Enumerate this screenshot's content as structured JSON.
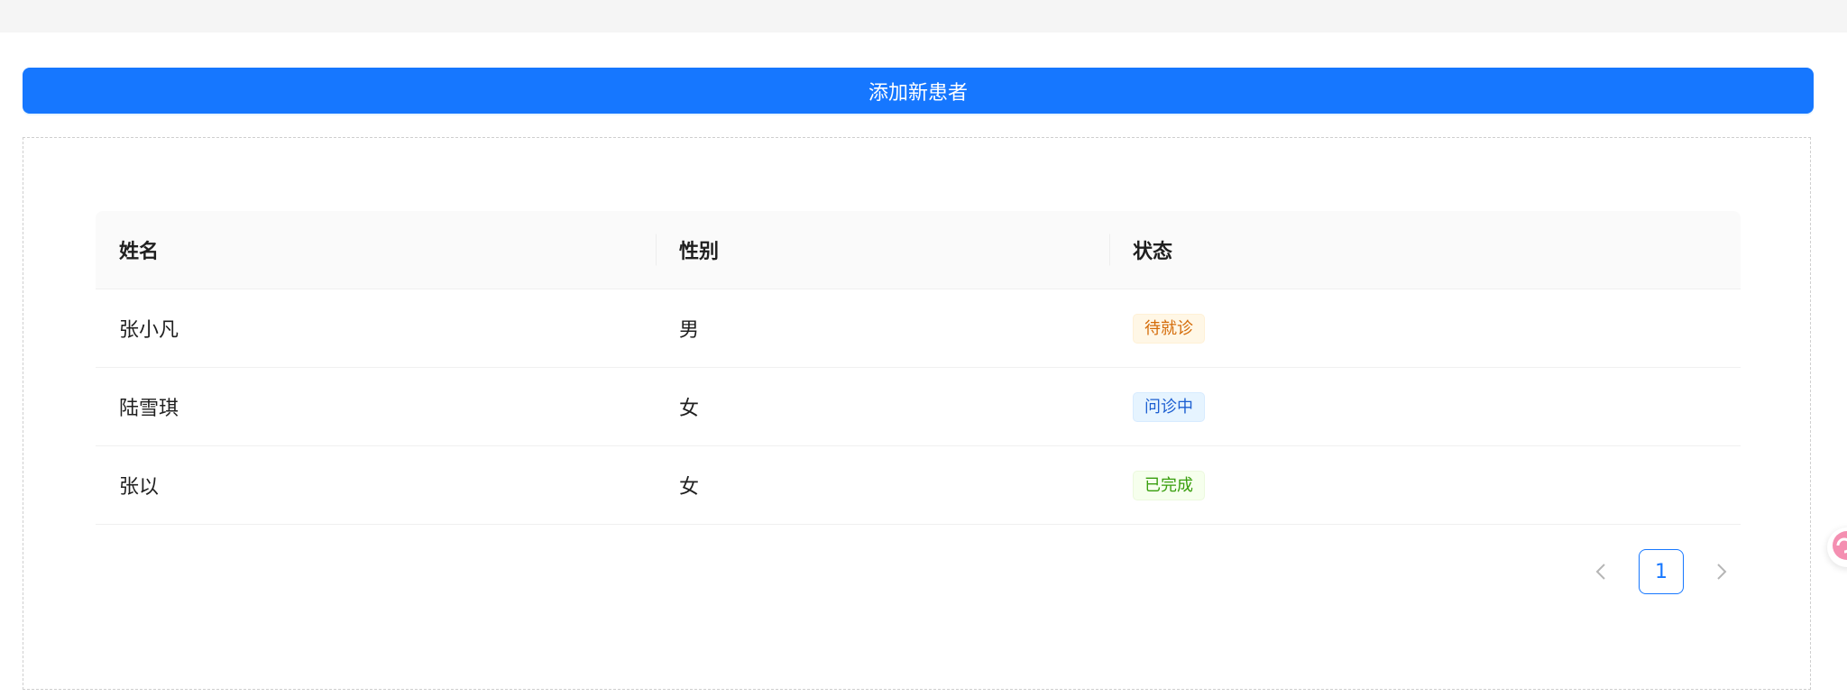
{
  "toolbar": {
    "add_patient_label": "添加新患者"
  },
  "table": {
    "columns": [
      "姓名",
      "性别",
      "状态"
    ],
    "rows": [
      {
        "name": "张小凡",
        "gender": "男",
        "status": "待就诊",
        "status_color": "#d46b08"
      },
      {
        "name": "陆雪琪",
        "gender": "女",
        "status": "问诊中",
        "status_color": "#1d5fd1"
      },
      {
        "name": "张以",
        "gender": "女",
        "status": "已完成",
        "status_color": "#389e0d"
      }
    ]
  },
  "pagination": {
    "current_page": "1",
    "prev_icon": "chevron-left-icon",
    "next_icon": "chevron-right-icon"
  },
  "colors": {
    "primary": "#1677ff",
    "floating_widget_accent": "#f06292"
  }
}
